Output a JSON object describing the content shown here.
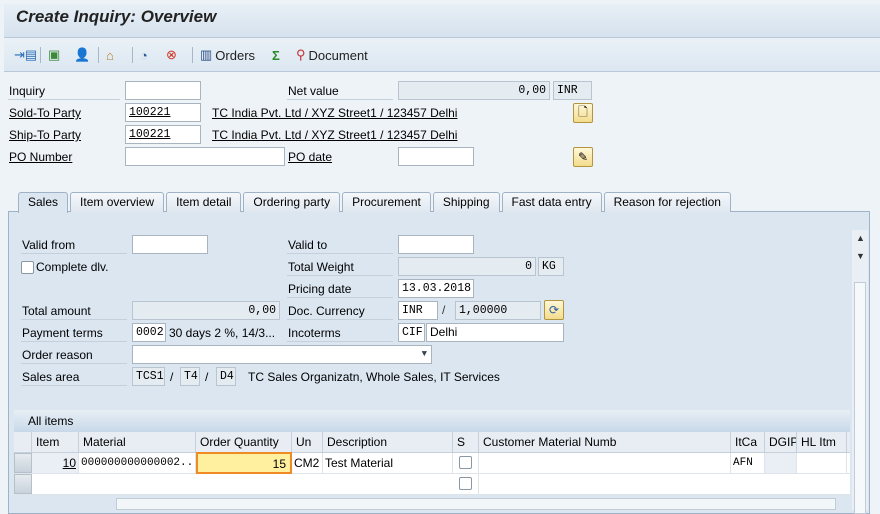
{
  "title": "Create Inquiry: Overview",
  "toolbar": {
    "orders": "Orders",
    "document": "Document",
    "icons": [
      "display-doc-header-icon",
      "header-details-icon",
      "business-partner-icon",
      "hierarchy-icon",
      "availability-icon",
      "cancel-icon",
      "orders-icon",
      "sum-icon",
      "document-flow-icon"
    ]
  },
  "header": {
    "inquiry_label": "Inquiry",
    "inquiry_value": "",
    "net_value_label": "Net value",
    "net_value": "0,00",
    "net_currency": "INR",
    "sold_to_label": "Sold-To Party",
    "sold_to_value": "100221",
    "sold_to_desc": "TC India Pvt. Ltd / XYZ Street1 / 123457 Delhi",
    "ship_to_label": "Ship-To Party",
    "ship_to_value": "100221",
    "ship_to_desc": "TC India Pvt. Ltd / XYZ Street1 / 123457 Delhi",
    "po_number_label": "PO Number",
    "po_number_value": "",
    "po_date_label": "PO date",
    "po_date_value": ""
  },
  "tabs": [
    "Sales",
    "Item overview",
    "Item detail",
    "Ordering party",
    "Procurement",
    "Shipping",
    "Fast data entry",
    "Reason for rejection"
  ],
  "active_tab": "Sales",
  "sales": {
    "valid_from_label": "Valid from",
    "valid_from": "",
    "valid_to_label": "Valid to",
    "valid_to": "",
    "complete_dlv_label": "Complete dlv.",
    "complete_dlv": false,
    "total_weight_label": "Total Weight",
    "total_weight": "0",
    "weight_unit": "KG",
    "pricing_date_label": "Pricing date",
    "pricing_date": "13.03.2018",
    "total_amount_label": "Total amount",
    "total_amount": "0,00",
    "doc_currency_label": "Doc. Currency",
    "doc_currency": "INR",
    "exchange_rate": "1,00000",
    "payment_terms_label": "Payment terms",
    "payment_terms": "0002",
    "payment_terms_desc": "30 days 2 %, 14/3...",
    "incoterms_label": "Incoterms",
    "incoterms": "CIF",
    "incoterms_place": "Delhi",
    "order_reason_label": "Order reason",
    "order_reason": "",
    "sales_area_label": "Sales area",
    "sales_org": "TCS1",
    "dist_channel": "T4",
    "division": "D4",
    "sales_area_desc": "TC Sales Organizatn, Whole Sales, IT Services",
    "slash": "/"
  },
  "items": {
    "title": "All items",
    "columns": [
      "Item",
      "Material",
      "Order Quantity",
      "Un",
      "Description",
      "S",
      "Customer Material Numb",
      "ItCa",
      "DGIP",
      "HL Itm"
    ],
    "rows": [
      {
        "item": "10",
        "material": "000000000000002...",
        "qty": "15",
        "unit": "CM2",
        "description": "Test Material",
        "s": false,
        "cust_mat": "",
        "itca": "AFN",
        "dgip": "",
        "hl": ""
      }
    ]
  },
  "colors": {
    "accent_focus": "#f08a24",
    "focus_bg": "#fff0a0",
    "panel": "#dbe6f1"
  }
}
